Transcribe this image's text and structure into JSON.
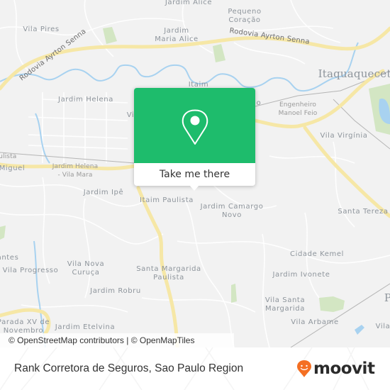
{
  "map": {
    "labels": {
      "jardim_alice": "Jardim Alice",
      "pequeno_coracao": "Pequeno\nCoração",
      "vila_pires": "Vila Pires",
      "jardim_maria_alice": "Jardim\nMaria Alice",
      "rodovia_ayrton_senna_1": "Rodovia Ayrton Senna",
      "rodovia_ayrton_senna_2": "Rodovia Ayrton Senna",
      "itaquaquecetuba": "Itaquaquecetu",
      "itaim": "Itaim",
      "jardim_helena": "Jardim Helena",
      "vi_partial": "Vi",
      "o_partial": "o",
      "engenheiro_manoel_feio": "Engenheiro\nManoel Feio",
      "vila_virginia": "Vila Virgínia",
      "paulista_partial": "aulista",
      "miguel_partial": "Miguel",
      "jardim_helena_vila_mara": "Jardim Helena\n- Vila Mara",
      "jardim_ipe": "Jardim Ipê",
      "itaim_paulista": "Itaim Paulista",
      "jardim_camargo_novo": "Jardim Camargo\nNovo",
      "santa_tereza": "Santa Tereza",
      "cidade_kemel": "Cidade Kemel",
      "antes_partial": "antes",
      "vila_progresso": "Vila Progresso",
      "vila_nova_curuca": "Vila Nova\nCuruça",
      "santa_margarida_paulista": "Santa Margarida\nPaulista",
      "jardim_ivonete": "Jardim Ivonete",
      "jardim_robru": "Jardim Robru",
      "vila_santa_margarida": "Vila Santa\nMargarida",
      "p_partial": "P",
      "parada_xv": "Parada XV de\nNovembro",
      "jardim_etelvina": "Jardim Etelvina",
      "vila_arbame": "Vila Arbame",
      "vila_partial": "Vila"
    },
    "attribution": "© OpenStreetMap contributors | © OpenMapTiles",
    "colors": {
      "background": "#f2f2f2",
      "road_major": "#f6e7a6",
      "water": "#a8d2f0",
      "park": "#d3e6c3",
      "accent": "#1ebc6c"
    }
  },
  "popup": {
    "icon": "location-pin-icon",
    "cta_label": "Take me there"
  },
  "footer": {
    "title": "Rank Corretora de Seguros, Sao Paulo Region",
    "brand": "moovit",
    "brand_color": "#f46f23"
  }
}
